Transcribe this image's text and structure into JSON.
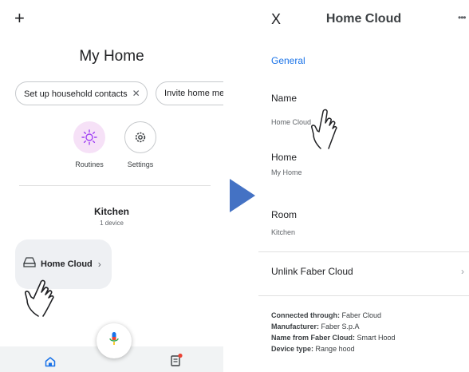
{
  "left_screen": {
    "add_icon": "plus-icon",
    "title": "My Home",
    "chips": [
      {
        "label": "Set up household contacts",
        "dismiss": "✕"
      },
      {
        "label": "Invite home me"
      }
    ],
    "actions": [
      {
        "label": "Routines",
        "icon": "sun-icon",
        "bg": "#f6e1f7"
      },
      {
        "label": "Settings",
        "icon": "gear-icon"
      }
    ],
    "room": {
      "name": "Kitchen",
      "device_count": "1 device"
    },
    "device": {
      "name": "Home Cloud",
      "icon": "range-hood-icon",
      "chevron": "›"
    },
    "mic_icon": "mic-icon",
    "nav": {
      "home_icon": "home-icon",
      "feed_icon": "feed-icon"
    },
    "colors": {
      "accent": "#1a73e8",
      "routines_bg": "#f6e1f7",
      "nav_bg": "#f1f3f4",
      "badge": "#ea4335"
    }
  },
  "arrow_icon": "triangle-right-icon",
  "right_screen": {
    "close": "X",
    "title": "Home Cloud",
    "more": "•••",
    "section": "General",
    "fields": [
      {
        "label": "Name",
        "value": "Home Cloud"
      },
      {
        "label": "Home",
        "value": "My Home"
      },
      {
        "label": "Room",
        "value": "Kitchen"
      }
    ],
    "unlink": "Unlink Faber Cloud",
    "unlink_chevron": "›",
    "info": [
      {
        "label": "Connected through:",
        "value": "Faber Cloud"
      },
      {
        "label": "Manufacturer:",
        "value": "Faber S.p.A"
      },
      {
        "label": "Name from Faber Cloud:",
        "value": "Smart Hood"
      },
      {
        "label": "Device type:",
        "value": "Range hood"
      }
    ]
  }
}
